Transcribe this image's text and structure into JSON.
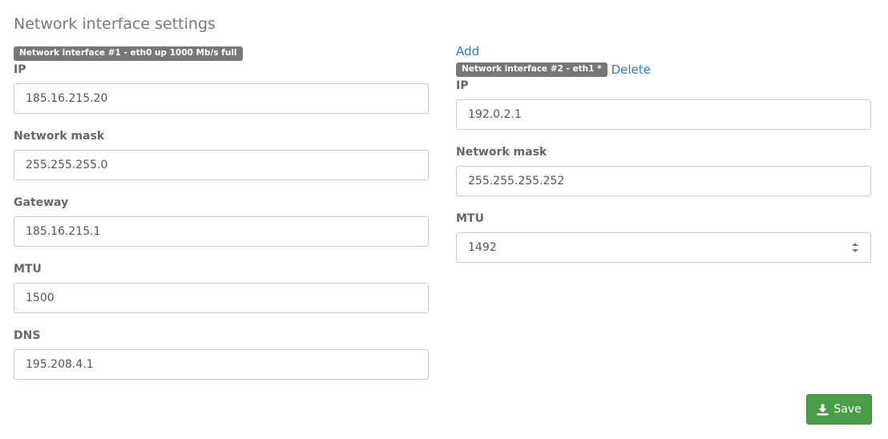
{
  "page": {
    "title": "Network interface settings"
  },
  "interfaces": [
    {
      "badge": "Network interface #1 - eth0 up 1000 Mb/s full",
      "fields": {
        "ip": {
          "label": "IP",
          "value": "185.16.215.20"
        },
        "mask": {
          "label": "Network mask",
          "value": "255.255.255.0"
        },
        "gateway": {
          "label": "Gateway",
          "value": "185.16.215.1"
        },
        "mtu": {
          "label": "MTU",
          "value": "1500"
        },
        "dns": {
          "label": "DNS",
          "value": "195.208.4.1"
        }
      }
    },
    {
      "add_label": "Add",
      "badge": "Network interface #2 - eth1 *",
      "delete_label": "Delete",
      "fields": {
        "ip": {
          "label": "IP",
          "value": "192.0.2.1"
        },
        "mask": {
          "label": "Network mask",
          "value": "255.255.255.252"
        },
        "mtu": {
          "label": "MTU",
          "value": "1492"
        }
      }
    }
  ],
  "actions": {
    "save_label": "Save"
  },
  "colors": {
    "badge": "#777777",
    "link": "#337ab7",
    "save": "#4a9e48"
  }
}
